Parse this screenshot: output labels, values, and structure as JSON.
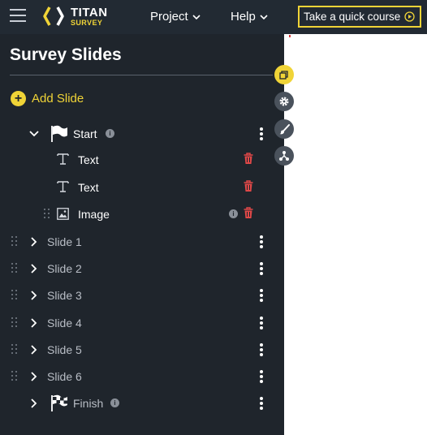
{
  "header": {
    "logo_line1": "TITAN",
    "logo_line2": "SURVEY",
    "nav": [
      {
        "label": "Project"
      },
      {
        "label": "Help"
      }
    ],
    "course_button": "Take a quick course"
  },
  "sidebar": {
    "title": "Survey Slides",
    "add_slide": "Add Slide",
    "start": {
      "label": "Start",
      "children": [
        {
          "type": "text",
          "label": "Text"
        },
        {
          "type": "text",
          "label": "Text"
        },
        {
          "type": "image",
          "label": "Image"
        }
      ]
    },
    "slides": [
      {
        "label": "Slide 1"
      },
      {
        "label": "Slide 2"
      },
      {
        "label": "Slide 3"
      },
      {
        "label": "Slide 4"
      },
      {
        "label": "Slide 5"
      },
      {
        "label": "Slide 6"
      }
    ],
    "finish": {
      "label": "Finish"
    }
  },
  "tools": [
    {
      "icon": "copy-icon",
      "active": true
    },
    {
      "icon": "gear-icon",
      "active": false
    },
    {
      "icon": "brush-icon",
      "active": false
    },
    {
      "icon": "share-network-icon",
      "active": false
    }
  ],
  "colors": {
    "accent": "#f0d437",
    "sidebar_bg": "#1f252c",
    "header_bg": "#222a33",
    "delete": "#e04848"
  }
}
